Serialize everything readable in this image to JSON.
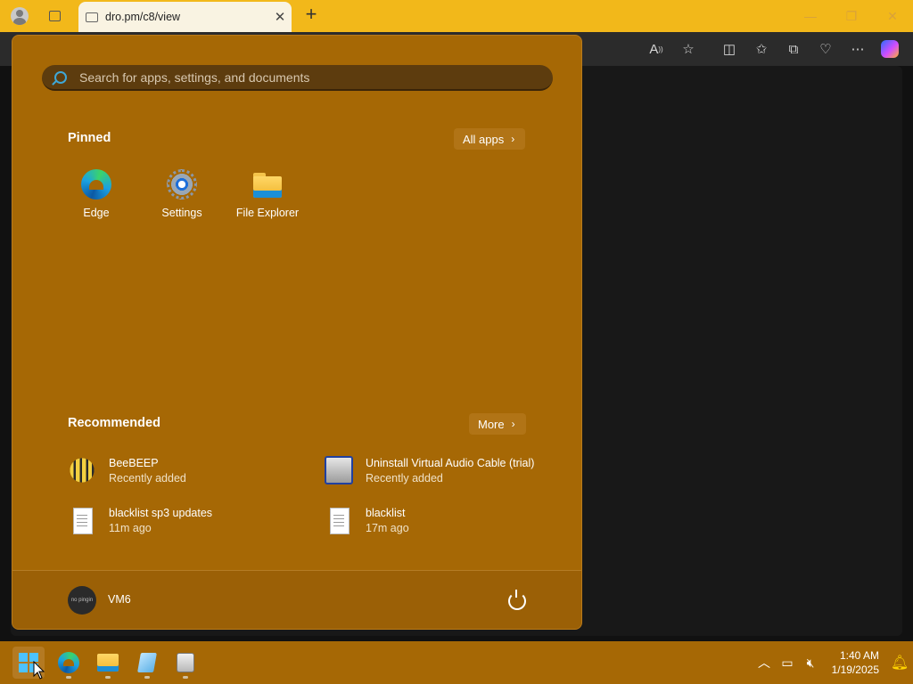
{
  "browser": {
    "tab_title": "dro.pm/c8/view",
    "new_tab_symbol": "+",
    "tab_close_symbol": "✕",
    "window_controls": [
      "—",
      "❐",
      "✕"
    ],
    "toolbar_icons": [
      "read-aloud",
      "favorite-star",
      "split-screen",
      "favorites",
      "collections",
      "browser-essentials",
      "more",
      "copilot"
    ]
  },
  "start_menu": {
    "search_placeholder": "Search for apps, settings, and documents",
    "pinned": {
      "title": "Pinned",
      "all_apps_label": "All apps",
      "apps": [
        {
          "label": "Edge",
          "icon": "edge-icon"
        },
        {
          "label": "Settings",
          "icon": "settings-gear-icon"
        },
        {
          "label": "File Explorer",
          "icon": "folder-icon"
        }
      ]
    },
    "recommended": {
      "title": "Recommended",
      "more_label": "More",
      "items": [
        {
          "name": "BeeBEEP",
          "sub": "Recently added",
          "icon": "bee-icon"
        },
        {
          "name": "Uninstall Virtual Audio Cable (trial)",
          "sub": "Recently added",
          "icon": "uninstaller-icon"
        },
        {
          "name": "blacklist sp3 updates",
          "sub": "11m ago",
          "icon": "document-icon"
        },
        {
          "name": "blacklist",
          "sub": "17m ago",
          "icon": "document-icon"
        }
      ]
    },
    "user": {
      "name": "VM6",
      "avatar_text": "no pingin"
    }
  },
  "taskbar": {
    "apps": [
      "start",
      "edge",
      "file-explorer",
      "notepad",
      "installer"
    ],
    "clock_time": "1:40 AM",
    "clock_date": "1/19/2025",
    "tray_chevron": "^"
  },
  "colors": {
    "accent": "#a66805",
    "tabstrip": "#f2b81a",
    "search_bg": "#5d3c0e"
  }
}
